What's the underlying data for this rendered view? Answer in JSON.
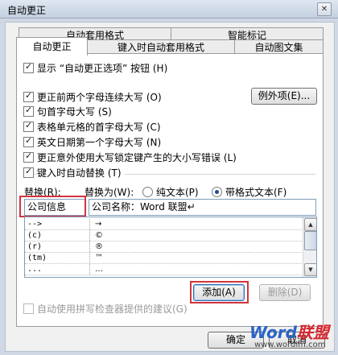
{
  "window": {
    "title": "自动更正",
    "close_glyph": "✕"
  },
  "tabs": {
    "top": [
      "自动套用格式",
      "智能标记"
    ],
    "bottom": [
      "自动更正",
      "键入时自动套用格式",
      "自动图文集"
    ]
  },
  "options": [
    {
      "label": "显示 “自动更正选项” 按钮 (H)",
      "checked": true
    },
    {
      "label": "更正前两个字母连续大写 (O)",
      "checked": true
    },
    {
      "label": "句首字母大写 (S)",
      "checked": true
    },
    {
      "label": "表格单元格的首字母大写 (C)",
      "checked": true
    },
    {
      "label": "英文日期第一个字母大写 (N)",
      "checked": true
    },
    {
      "label": "更正意外使用大写锁定键产生的大小写错误 (L)",
      "checked": true
    },
    {
      "label": "键入时自动替换 (T)",
      "checked": true
    }
  ],
  "buttons": {
    "exceptions": "例外项(E)...",
    "add": "添加(A)",
    "delete": "删除(D)",
    "ok": "确定",
    "cancel": "取消"
  },
  "replace": {
    "replace_label": "替换(R):",
    "with_label": "替换为(W):",
    "radio_plain": "纯文本(P)",
    "radio_formatted": "带格式文本(F)",
    "selected": "formatted",
    "replace_value": "公司信息",
    "with_value": "公司名称：Word 联盟↵"
  },
  "list_rows": [
    {
      "from": "-->",
      "to": "→"
    },
    {
      "from": "(c)",
      "to": "©"
    },
    {
      "from": "(r)",
      "to": "®"
    },
    {
      "from": "(tm)",
      "to": "™"
    },
    {
      "from": "...",
      "to": "…"
    }
  ],
  "spell_suggest": {
    "label": "自动使用拼写检查器提供的建议(G)",
    "checked": false,
    "enabled": false
  },
  "watermark": {
    "brand_a": "Word",
    "brand_b": "联盟",
    "url": "www.wordlm.com"
  },
  "colors": {
    "highlight": "#d2343c",
    "radio_dot": "#1e4f8f"
  }
}
